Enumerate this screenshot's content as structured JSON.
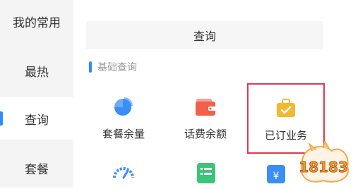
{
  "sidebar": {
    "items": [
      {
        "label": "我的常用",
        "active": false
      },
      {
        "label": "最热",
        "active": false
      },
      {
        "label": "查询",
        "active": true
      },
      {
        "label": "套餐",
        "active": false
      }
    ]
  },
  "main": {
    "panel_title": "查询",
    "section": "基础查询",
    "tiles": [
      {
        "label": "套餐余量",
        "icon": "pie-chart-icon",
        "color": "#3a8ef6"
      },
      {
        "label": "话费余额",
        "icon": "wallet-icon",
        "color": "#f0604a"
      },
      {
        "label": "已订业务",
        "icon": "briefcase-check-icon",
        "color": "#f5b830",
        "highlighted": true
      }
    ],
    "bottom_icons": [
      {
        "icon": "speedometer-icon",
        "color": "#3a8ef6"
      },
      {
        "icon": "list-icon",
        "color": "#3cc57a"
      },
      {
        "icon": "yuan-card-icon",
        "color": "#3a8ef6"
      }
    ]
  },
  "colors": {
    "accent": "#2f8cff",
    "highlight_border": "#e0394f",
    "sidebar_bg": "#f4f4f4"
  },
  "watermark": {
    "text": "18183"
  }
}
